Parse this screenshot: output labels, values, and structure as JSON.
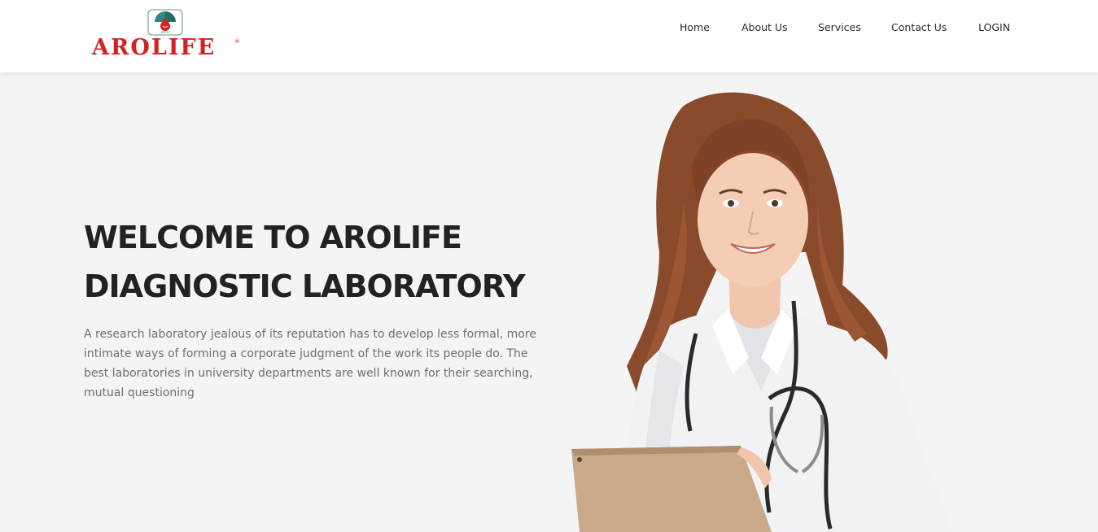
{
  "brand": {
    "name": "AROLIFE",
    "registered_mark": "®",
    "emblem_text": "AROLIFE",
    "color": "#d3221f",
    "emblem_color": "#1f6f6a"
  },
  "nav": {
    "items": [
      {
        "label": "Home"
      },
      {
        "label": "About Us"
      },
      {
        "label": "Services"
      },
      {
        "label": "Contact Us"
      },
      {
        "label": "LOGIN"
      }
    ]
  },
  "hero": {
    "title_line1": "WELCOME TO AROLIFE",
    "title_line2": "DIAGNOSTIC LABORATORY",
    "description": "A research laboratory jealous of its reputation has to develop less formal, more intimate ways of forming a corporate judgment of the work its people do. The best laboratories in university departments are well known for their searching, mutual questioning",
    "image_icon": "doctor-with-tablet-photo"
  },
  "colors": {
    "background": "#f4f4f5",
    "header_bg": "#ffffff",
    "text_dark": "#222222",
    "text_muted": "#6f6f6f"
  }
}
